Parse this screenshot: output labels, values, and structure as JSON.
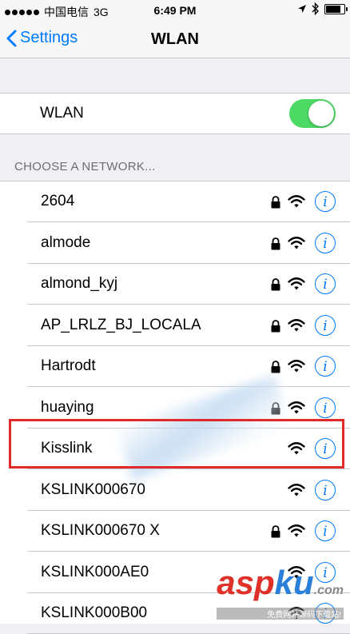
{
  "status_bar": {
    "carrier": "中国电信",
    "network": "3G",
    "time": "6:49 PM"
  },
  "nav": {
    "back_label": "Settings",
    "title": "WLAN"
  },
  "wlan_toggle": {
    "label": "WLAN",
    "on": true,
    "color": "#4cd964"
  },
  "section_header": "CHOOSE A NETWORK...",
  "networks": [
    {
      "name": "2604",
      "locked": true
    },
    {
      "name": "almode",
      "locked": true
    },
    {
      "name": "almond_kyj",
      "locked": true
    },
    {
      "name": "AP_LRLZ_BJ_LOCALA",
      "locked": true
    },
    {
      "name": "Hartrodt",
      "locked": true
    },
    {
      "name": "huaying",
      "locked": true
    },
    {
      "name": "Kisslink",
      "locked": false,
      "highlighted": true
    },
    {
      "name": "KSLINK000670",
      "locked": false
    },
    {
      "name": "KSLINK000670 X",
      "locked": true
    },
    {
      "name": "KSLINK000AE0",
      "locked": false
    },
    {
      "name": "KSLINK000B00",
      "locked": false
    }
  ],
  "info_glyph": "i",
  "accent_color": "#007aff",
  "highlight_color": "#e02a2a",
  "watermark": {
    "logo_main": "asp",
    "logo_accent": "ku",
    "logo_suffix": ".com",
    "tagline": "免费网站源码下载站!"
  }
}
